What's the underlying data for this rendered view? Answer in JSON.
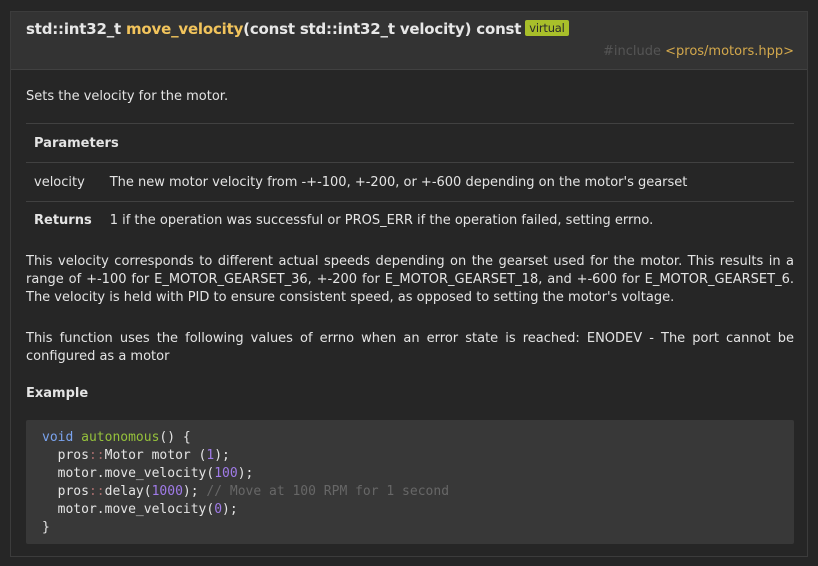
{
  "header": {
    "return_type": "std::int32_t",
    "function_name": "move_velocity",
    "params_signature": "(const std::int32_t velocity) const",
    "badge": "virtual",
    "include_keyword": "#include",
    "include_header": "<pros/motors.hpp>"
  },
  "description": "Sets the velocity for the motor.",
  "parameters": {
    "heading": "Parameters",
    "items": [
      {
        "name": "velocity",
        "description": "The new motor velocity from -+-100, +-200, or +-600 depending on the motor's gearset"
      }
    ]
  },
  "returns": {
    "label": "Returns",
    "text": "1 if the operation was successful or PROS_ERR if the operation failed, setting errno."
  },
  "paragraphs": [
    "This velocity corresponds to different actual speeds depending on the gearset used for the motor. This results in a range of +-100 for E_MOTOR_GEARSET_36, +-200 for E_MOTOR_GEARSET_18, and +-600 for E_MOTOR_GEARSET_6. The velocity is held with PID to ensure consistent speed, as opposed to setting the motor's voltage.",
    "This function uses the following values of errno when an error state is reached: ENODEV - The port cannot be configured as a motor"
  ],
  "example": {
    "title": "Example",
    "code": {
      "kw_void": "void",
      "fn_autonomous": "autonomous",
      "parens_open": "() {",
      "pros1": "pros",
      "sep": "::",
      "motor_decl": "Motor motor (",
      "port": "1",
      "decl_end": ");",
      "mv_call": "motor.move_velocity(",
      "mv_value": "100",
      "mv_end": ");",
      "pros2": "pros",
      "delay_call": "delay(",
      "delay_value": "1000",
      "delay_end": ");",
      "comment": "// Move at 100 RPM for 1 second",
      "mv_call2": "motor.move_velocity(",
      "mv_value2": "0",
      "mv_end2": ");",
      "close": "}"
    }
  }
}
